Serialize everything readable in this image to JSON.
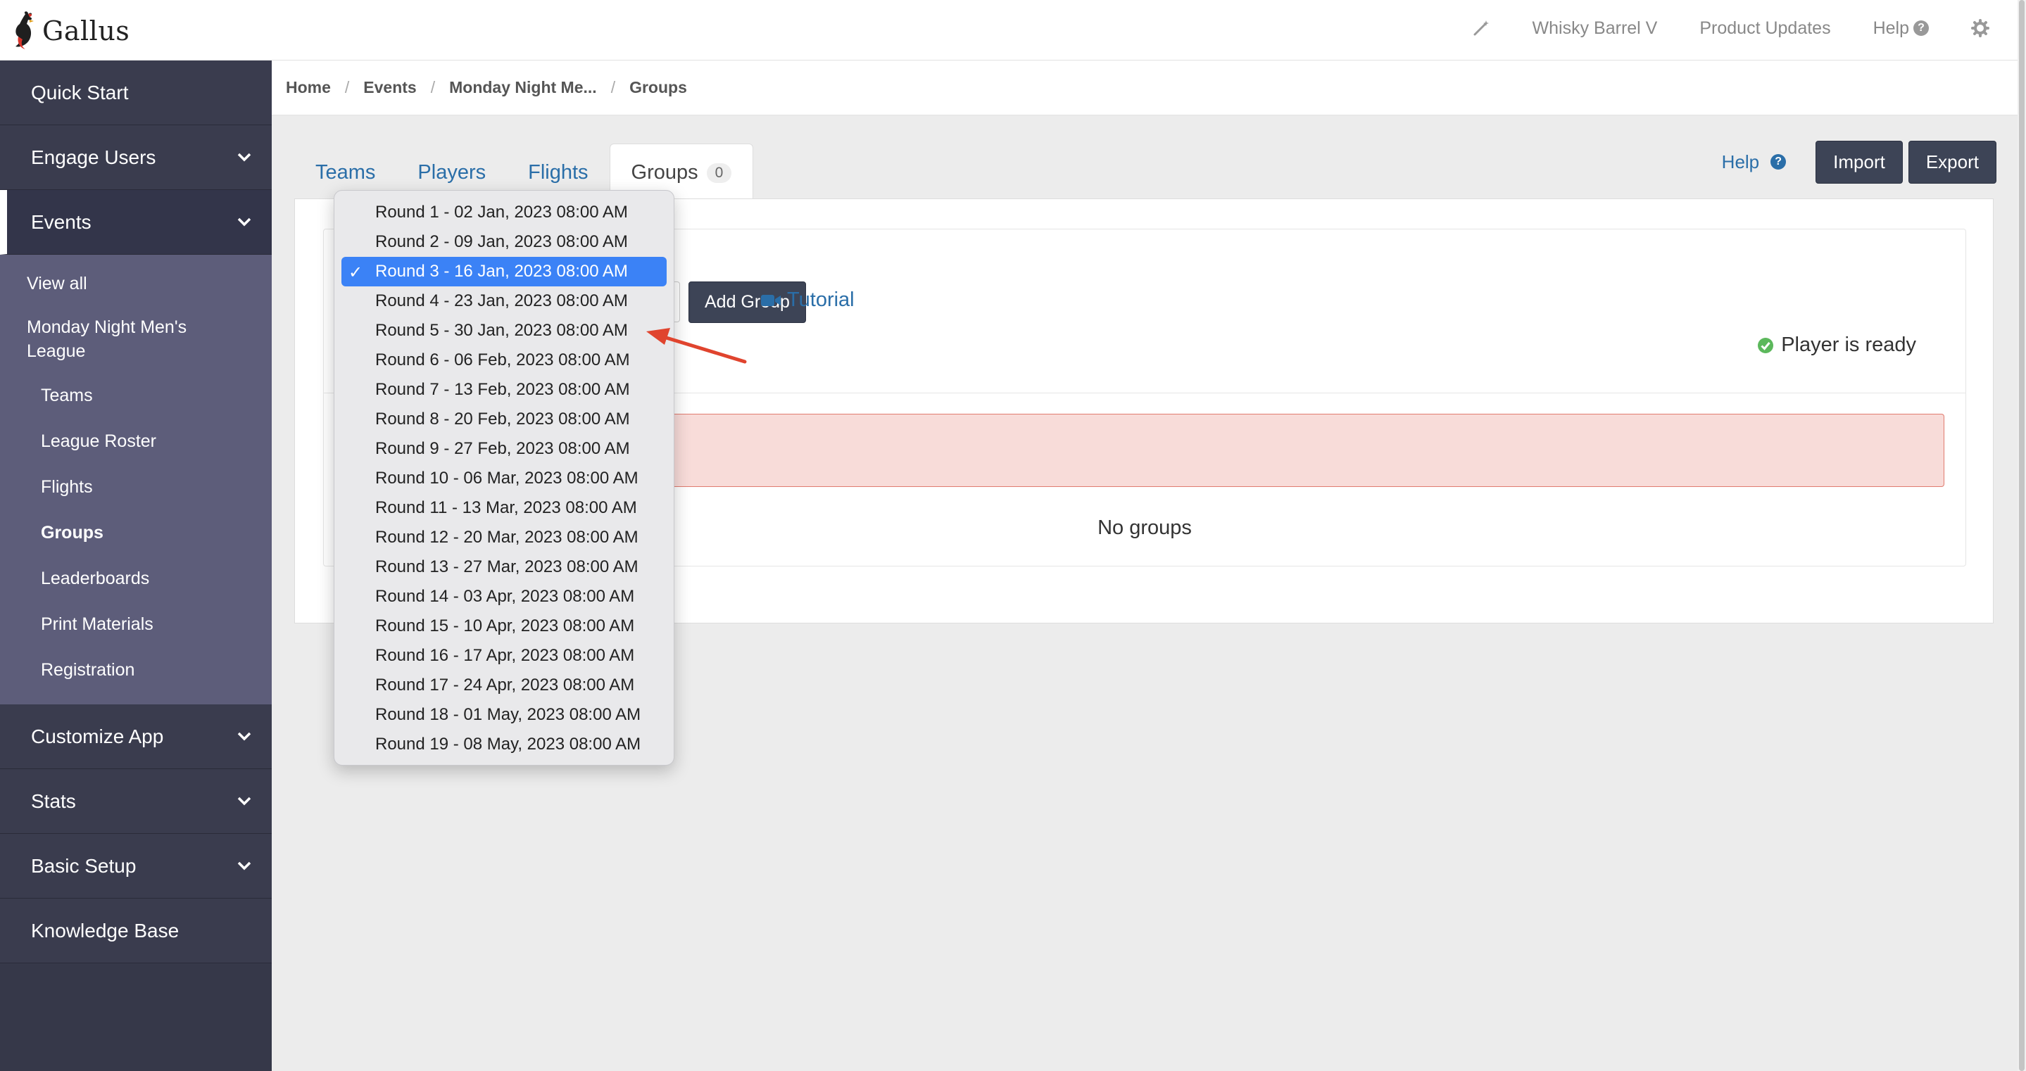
{
  "brand": {
    "name": "Gallus"
  },
  "topnav": {
    "org": "Whisky Barrel V",
    "updates": "Product Updates",
    "help": "Help",
    "help_mark": "?"
  },
  "sidebar": {
    "quick_start": "Quick Start",
    "engage_users": "Engage Users",
    "events": "Events",
    "events_sub": {
      "view_all": "View all",
      "league": "Monday Night Men's League",
      "items": [
        "Teams",
        "League Roster",
        "Flights",
        "Groups",
        "Leaderboards",
        "Print Materials",
        "Registration"
      ]
    },
    "customize_app": "Customize App",
    "stats": "Stats",
    "basic_setup": "Basic Setup",
    "knowledge_base": "Knowledge Base"
  },
  "breadcrumb": [
    "Home",
    "Events",
    "Monday Night Me...",
    "Groups"
  ],
  "tabs": {
    "teams": "Teams",
    "players": "Players",
    "flights": "Flights",
    "groups": "Groups",
    "groups_count": "0"
  },
  "actions": {
    "help": "Help",
    "help_mark": "?",
    "import": "Import",
    "export": "Export"
  },
  "panel": {
    "add_group": "Add Group",
    "tutorial": "Tutorial",
    "status": "Player is ready",
    "empty": "No groups"
  },
  "round_select": {
    "selected_index": 2,
    "tick": "✓",
    "options": [
      "Round 1 - 02 Jan, 2023 08:00 AM",
      "Round 2 - 09 Jan, 2023 08:00 AM",
      "Round 3 - 16 Jan, 2023 08:00 AM",
      "Round 4 - 23 Jan, 2023 08:00 AM",
      "Round 5 - 30 Jan, 2023 08:00 AM",
      "Round 6 - 06 Feb, 2023 08:00 AM",
      "Round 7 - 13 Feb, 2023 08:00 AM",
      "Round 8 - 20 Feb, 2023 08:00 AM",
      "Round 9 - 27 Feb, 2023 08:00 AM",
      "Round 10 - 06 Mar, 2023 08:00 AM",
      "Round 11 - 13 Mar, 2023 08:00 AM",
      "Round 12 - 20 Mar, 2023 08:00 AM",
      "Round 13 - 27 Mar, 2023 08:00 AM",
      "Round 14 - 03 Apr, 2023 08:00 AM",
      "Round 15 - 10 Apr, 2023 08:00 AM",
      "Round 16 - 17 Apr, 2023 08:00 AM",
      "Round 17 - 24 Apr, 2023 08:00 AM",
      "Round 18 - 01 May, 2023 08:00 AM",
      "Round 19 - 08 May, 2023 08:00 AM"
    ]
  },
  "colors": {
    "sidebar_bg": "#363849",
    "subnav_bg": "#5d5d7a",
    "link": "#2a6ea8",
    "selected_option": "#3b82f6",
    "alert_bg": "#f8dcd9",
    "annotation_arrow": "#e0442e"
  }
}
